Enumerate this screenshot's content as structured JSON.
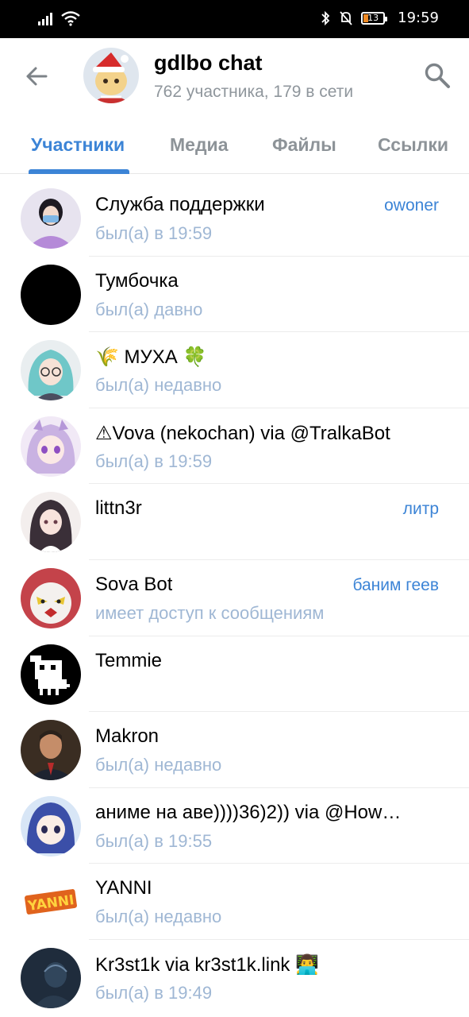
{
  "status_bar": {
    "time": "19:59",
    "battery_level": "13"
  },
  "header": {
    "title": "gdlbo chat",
    "subtitle": "762 участника, 179 в сети"
  },
  "tabs": [
    {
      "label": "Участники",
      "active": true
    },
    {
      "label": "Медиа",
      "active": false
    },
    {
      "label": "Файлы",
      "active": false
    },
    {
      "label": "Ссылки",
      "active": false
    }
  ],
  "members": [
    {
      "name": "Служба поддержки",
      "status": "был(а) в 19:59",
      "role": "owoner",
      "avatar": "girl-photo"
    },
    {
      "name": "Тумбочка",
      "status": "был(а) давно",
      "role": "",
      "avatar": "black-circle"
    },
    {
      "name": "🌾 МУХА 🍀",
      "status": "был(а) недавно",
      "role": "",
      "avatar": "anime-teal-hair"
    },
    {
      "name": "⚠Vova (nekochan) via @TralkaBot",
      "status": "был(а) в 19:59",
      "role": "",
      "avatar": "anime-purple-hair"
    },
    {
      "name": "littn3r",
      "status": "",
      "role": "литр",
      "avatar": "anime-dark-hair"
    },
    {
      "name": "Sova Bot",
      "status": "имеет доступ к сообщениям",
      "role": "баним геев",
      "avatar": "owl"
    },
    {
      "name": "Temmie",
      "status": "",
      "role": "",
      "avatar": "temmie-pixel"
    },
    {
      "name": "Makron",
      "status": "был(а) недавно",
      "role": "",
      "avatar": "man-photo"
    },
    {
      "name": "аниме на аве))))36)2)) via @How…",
      "status": "был(а) в 19:55",
      "role": "",
      "avatar": "anime-blue-hair"
    },
    {
      "name": "YANNI",
      "status": "был(а) недавно",
      "role": "",
      "avatar": "yanni-logo"
    },
    {
      "name": "Kr3st1k via kr3st1k.link 👨‍💻",
      "status": "был(а) в 19:49",
      "role": "",
      "avatar": "dark-photo"
    }
  ],
  "colors": {
    "accent": "#3c84d6",
    "status_text": "#9fb7d4",
    "subtitle_text": "#8f969c"
  }
}
